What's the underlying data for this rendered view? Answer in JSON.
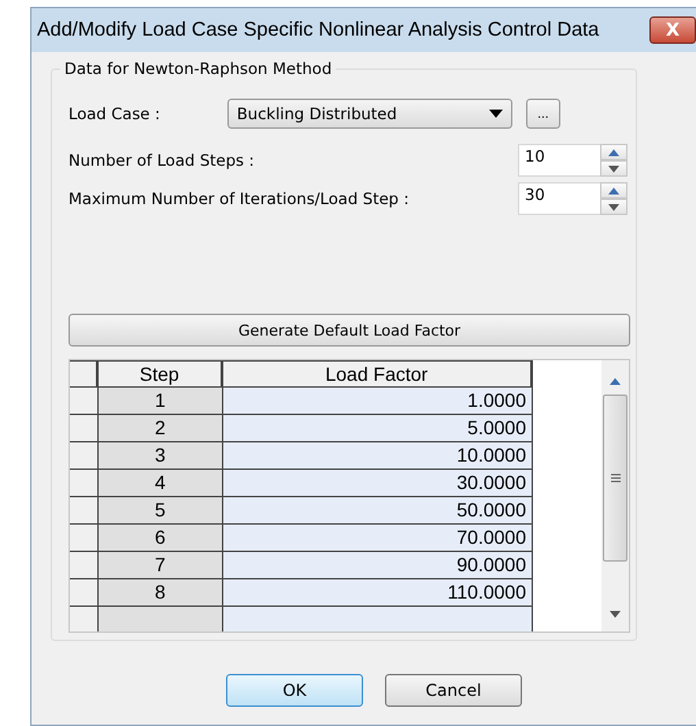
{
  "window": {
    "title": "Add/Modify Load Case Specific Nonlinear Analysis Control Data",
    "close": "X"
  },
  "group": {
    "title": "Data for Newton-Raphson Method"
  },
  "load_case": {
    "label": "Load Case :",
    "value": "Buckling Distributed",
    "browse": "..."
  },
  "load_steps": {
    "label": "Number of Load Steps :",
    "value": "10"
  },
  "max_iterations": {
    "label": "Maximum Number of Iterations/Load Step :",
    "value": "30"
  },
  "generate_button": "Generate Default Load Factor",
  "table": {
    "columns": [
      "Step",
      "Load Factor"
    ],
    "rows": [
      {
        "step": "1",
        "factor": "1.0000"
      },
      {
        "step": "2",
        "factor": "5.0000"
      },
      {
        "step": "3",
        "factor": "10.0000"
      },
      {
        "step": "4",
        "factor": "30.0000"
      },
      {
        "step": "5",
        "factor": "50.0000"
      },
      {
        "step": "6",
        "factor": "70.0000"
      },
      {
        "step": "7",
        "factor": "90.0000"
      },
      {
        "step": "8",
        "factor": "110.0000"
      }
    ]
  },
  "buttons": [
    {
      "label": "OK",
      "selected": true
    },
    {
      "label": "Cancel",
      "selected": false
    }
  ]
}
